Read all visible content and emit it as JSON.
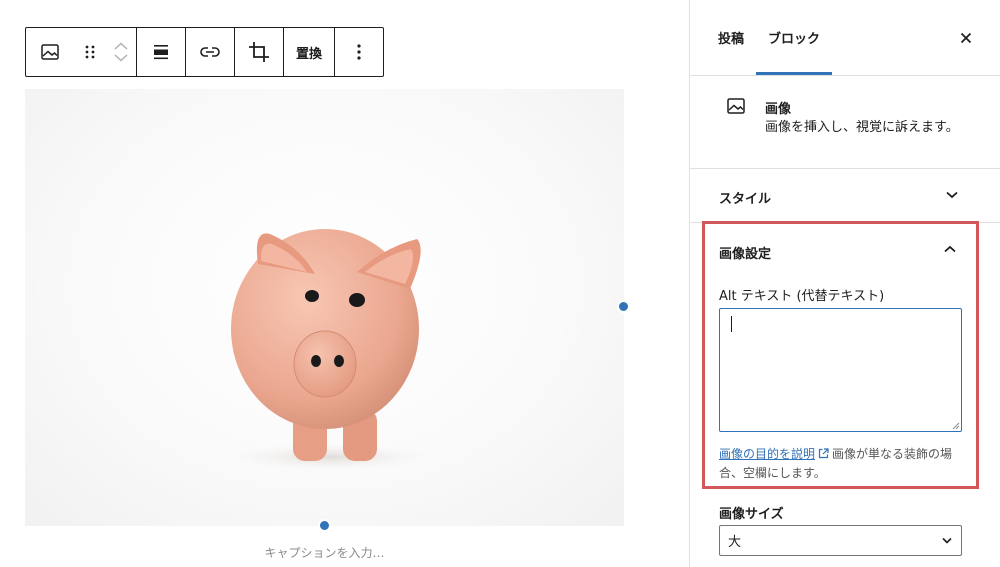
{
  "toolbar": {
    "replace_label": "置換"
  },
  "image": {
    "caption_placeholder": "キャプションを入力…"
  },
  "sidebar": {
    "tabs": [
      {
        "label": "投稿"
      },
      {
        "label": "ブロック"
      }
    ],
    "active_tab": "ブロック",
    "block_card": {
      "title": "画像",
      "description": "画像を挿入し、視覚に訴えます。"
    },
    "style_panel": {
      "title": "スタイル"
    },
    "image_settings": {
      "title": "画像設定",
      "alt_label": "Alt テキスト (代替テキスト)",
      "alt_value": "",
      "help_link": "画像の目的を説明",
      "help_text": "画像が単なる装飾の場合、空欄にします。"
    },
    "image_size": {
      "label": "画像サイズ",
      "selected": "大"
    }
  },
  "colors": {
    "accent": "#3172b9",
    "highlight_border": "#d1575a",
    "text": "#1e1e1e"
  }
}
